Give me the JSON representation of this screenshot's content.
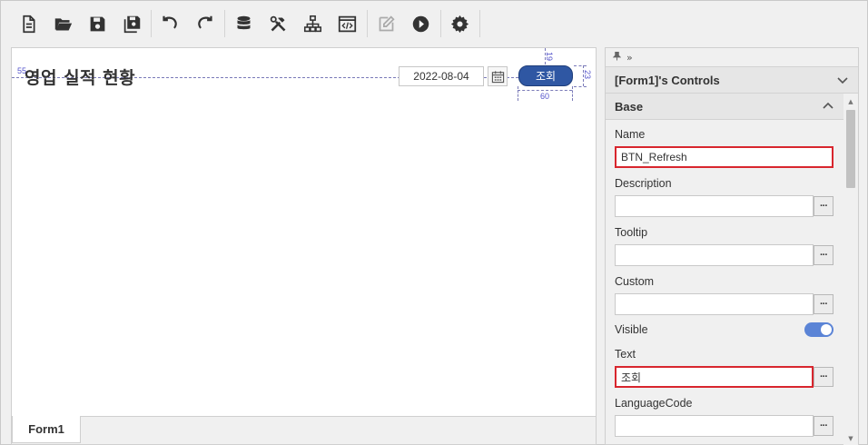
{
  "toolbar": {
    "buttons": [
      {
        "name": "new-file-icon"
      },
      {
        "name": "open-folder-icon"
      },
      {
        "name": "save-icon"
      },
      {
        "name": "save-all-icon"
      },
      {
        "name": "undo-icon"
      },
      {
        "name": "redo-icon"
      },
      {
        "name": "database-icon"
      },
      {
        "name": "tools-icon"
      },
      {
        "name": "hierarchy-icon"
      },
      {
        "name": "code-view-icon"
      },
      {
        "name": "edit-icon"
      },
      {
        "name": "run-icon"
      },
      {
        "name": "settings-icon"
      }
    ]
  },
  "designer": {
    "form_title": "영업 실적 현황",
    "date_value": "2022-08-04",
    "search_button_label": "조회",
    "guide_left_value": "55",
    "guide_top_value": "19",
    "guide_height_value": "23",
    "guide_width_value": "60",
    "tab_label": "Form1"
  },
  "panel": {
    "header_title": "[Form1]'s Controls",
    "section_title": "Base",
    "properties": [
      {
        "label": "Name",
        "value": "BTN_Refresh"
      },
      {
        "label": "Description",
        "value": ""
      },
      {
        "label": "Tooltip",
        "value": ""
      },
      {
        "label": "Custom",
        "value": ""
      },
      {
        "label": "Visible",
        "value": true
      },
      {
        "label": "Text",
        "value": "조회"
      },
      {
        "label": "LanguageCode",
        "value": ""
      }
    ],
    "ellipsis_label": "···"
  },
  "colors": {
    "accent_button": "#2f57a3",
    "highlight_border": "#d8262e",
    "toggle_on": "#5b84d6"
  }
}
